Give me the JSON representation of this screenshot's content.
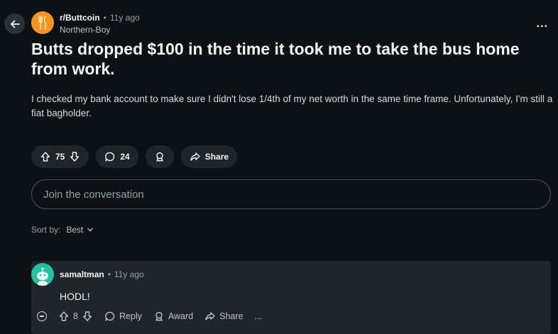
{
  "post": {
    "subreddit": "r/Buttcoin",
    "time": "11y ago",
    "author": "Northern-Boy",
    "title": "Butts dropped $100 in the time it took me to take the bus home from work.",
    "body": "I checked my bank account to make sure I didn't lose 1/4th of my net worth in the same time frame. Unfortunately, I'm still a fiat bagholder.",
    "votes": "75",
    "comments": "24",
    "share_label": "Share",
    "more_label": "..."
  },
  "join": {
    "placeholder": "Join the conversation"
  },
  "sort": {
    "label": "Sort by:",
    "value": "Best"
  },
  "comment": {
    "author": "samaltman",
    "time": "11y ago",
    "text": "HODL!",
    "votes": "8",
    "reply_label": "Reply",
    "award_label": "Award",
    "share_label": "Share",
    "more_label": "..."
  },
  "colors": {
    "accent_sub": "#f7941d",
    "avatar_comment": "#24c2a3",
    "background": "#0e1113"
  },
  "icons": [
    "back-arrow-icon",
    "more-icon",
    "upvote-icon",
    "downvote-icon",
    "comment-icon",
    "award-icon",
    "share-icon",
    "chevron-down-icon",
    "collapse-icon",
    "reply-icon"
  ]
}
